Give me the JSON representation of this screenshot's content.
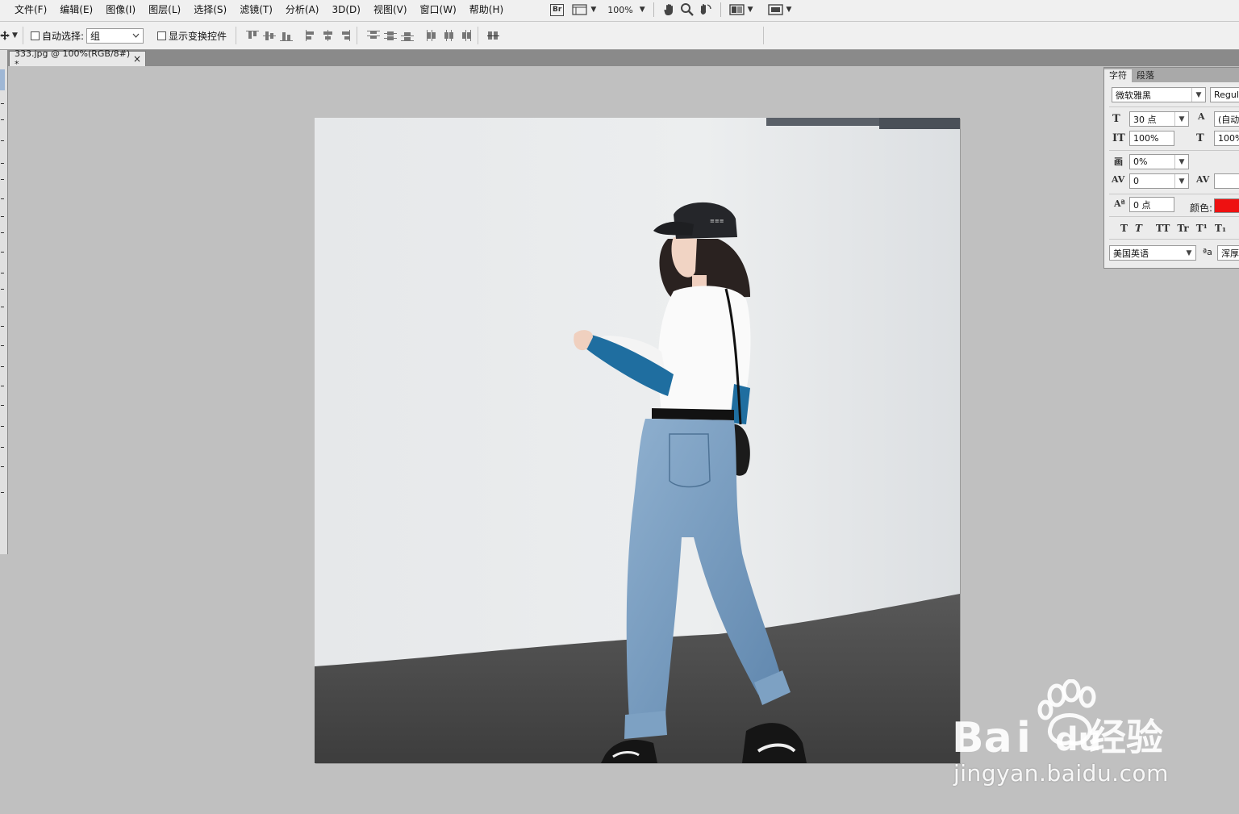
{
  "menubar": {
    "items": [
      "文件(F)",
      "编辑(E)",
      "图像(I)",
      "图层(L)",
      "选择(S)",
      "滤镜(T)",
      "分析(A)",
      "3D(D)",
      "视图(V)",
      "窗口(W)",
      "帮助(H)"
    ],
    "bridge_label": "Br",
    "zoom": "100%"
  },
  "options": {
    "auto_select_label": "自动选择:",
    "auto_select_value": "组",
    "show_transform_label": "显示变换控件"
  },
  "document": {
    "tab_title": "333.jpg @ 100%(RGB/8#) *",
    "close_glyph": "×"
  },
  "character_panel": {
    "tab_character": "字符",
    "tab_paragraph": "段落",
    "font_family": "微软雅黑",
    "font_style": "Regula",
    "font_size": "30 点",
    "leading": "(自动",
    "vertical_scale": "100%",
    "horizontal_scale": "100%",
    "tsume": "0%",
    "kerning": "0",
    "baseline_shift": "0 点",
    "color_label": "颜色:",
    "color_value": "#ee1111",
    "language": "美国英语",
    "antialias_label": "ªa",
    "antialias": "浑厚",
    "text_styles": [
      "T",
      "T",
      "TT",
      "Tr",
      "T¹",
      "T₁"
    ]
  },
  "watermark": {
    "brand": "Bai经验",
    "url": "jingyan.baidu.com"
  }
}
